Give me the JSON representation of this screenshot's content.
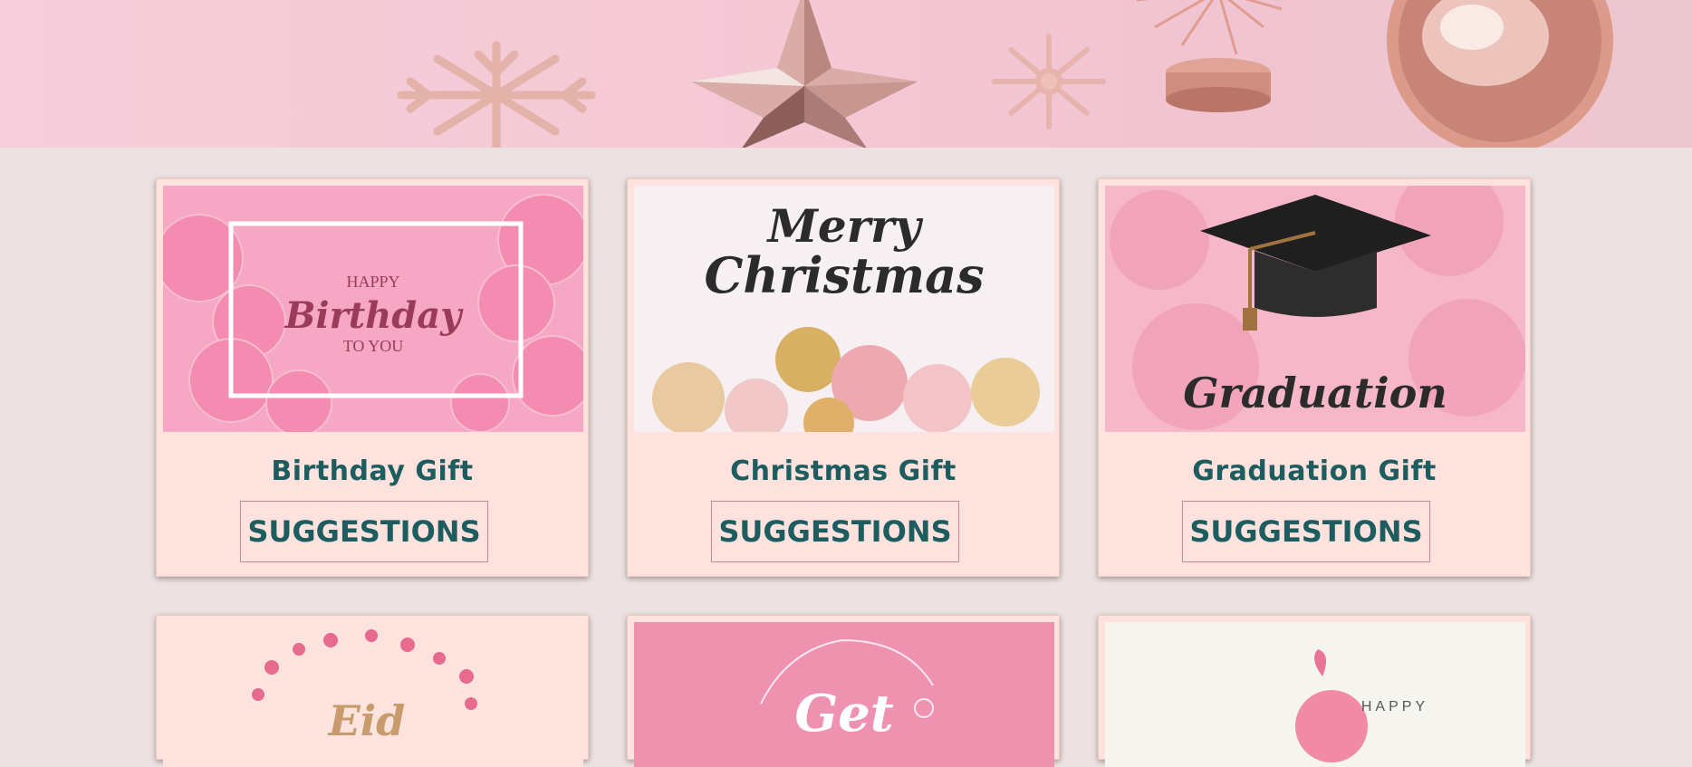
{
  "cards": [
    {
      "image_text": [
        "HAPPY",
        "Birthday",
        "TO YOU"
      ],
      "title": "Birthday Gift",
      "button": "SUGGESTIONS"
    },
    {
      "image_text": [
        "Merry",
        "Christmas"
      ],
      "title": "Christmas Gift",
      "button": "SUGGESTIONS"
    },
    {
      "image_text": [
        "Graduation"
      ],
      "title": "Graduation Gift",
      "button": "SUGGESTIONS"
    },
    {
      "image_text": [
        "Eid"
      ]
    },
    {
      "image_text": [
        "Get"
      ]
    },
    {
      "image_text": [
        "HAPPY"
      ]
    }
  ],
  "colors": {
    "page_bg": "#ece2e1",
    "card_bg": "#fee2dd",
    "accent_text": "#1d5c5f",
    "button_border": "#c98a93"
  }
}
